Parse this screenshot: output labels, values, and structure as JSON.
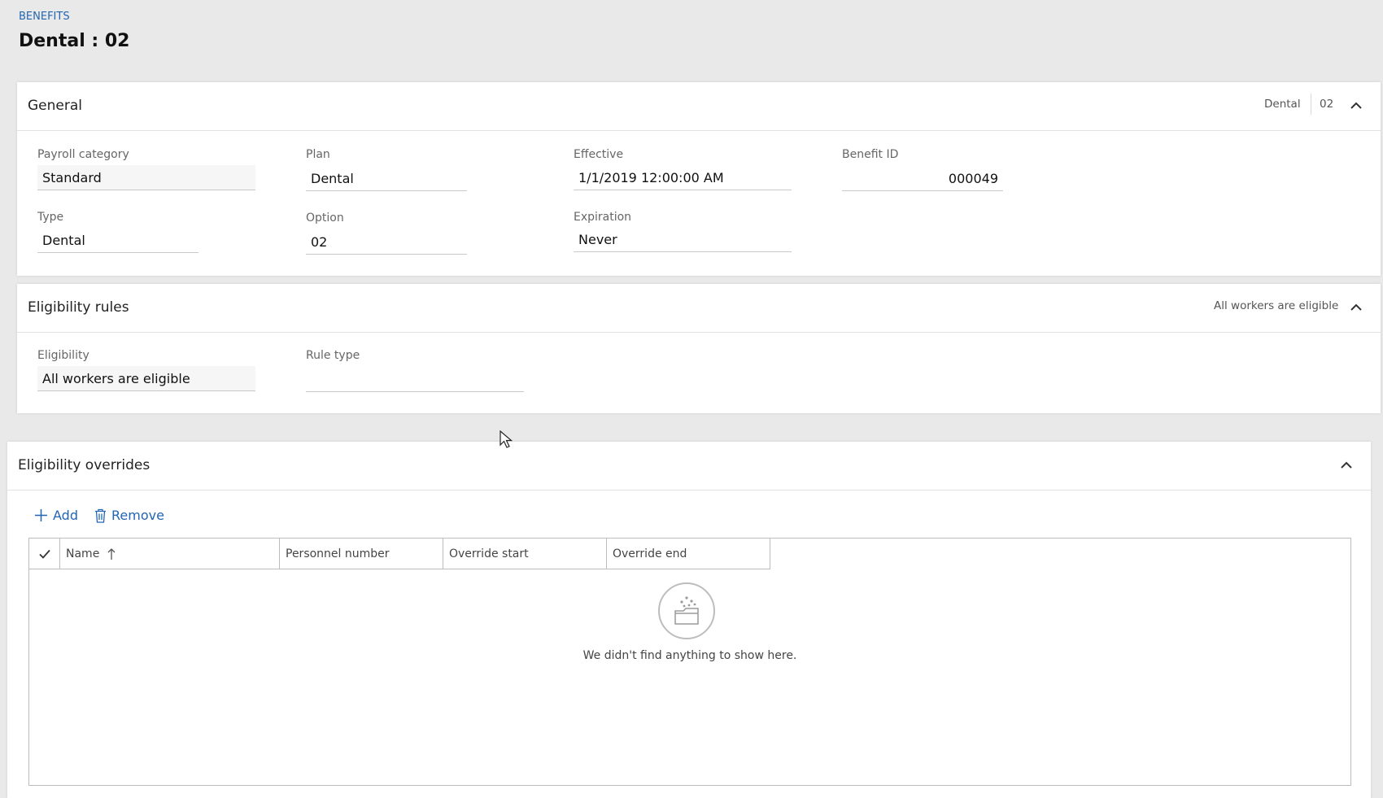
{
  "breadcrumb": "BENEFITS",
  "page_title": "Dental : 02",
  "general": {
    "title": "General",
    "summary": [
      "Dental",
      "02"
    ],
    "fields": {
      "payroll_category": {
        "label": "Payroll category",
        "value": "Standard"
      },
      "plan": {
        "label": "Plan",
        "value": "Dental"
      },
      "effective": {
        "label": "Effective",
        "value": "1/1/2019 12:00:00 AM"
      },
      "benefit_id": {
        "label": "Benefit ID",
        "value": "000049"
      },
      "type": {
        "label": "Type",
        "value": "Dental"
      },
      "option": {
        "label": "Option",
        "value": "02"
      },
      "expiration": {
        "label": "Expiration",
        "value": "Never"
      }
    }
  },
  "eligibility_rules": {
    "title": "Eligibility rules",
    "summary": "All workers are eligible",
    "fields": {
      "eligibility": {
        "label": "Eligibility",
        "value": "All workers are eligible"
      },
      "rule_type": {
        "label": "Rule type",
        "value": ""
      }
    }
  },
  "eligibility_overrides": {
    "title": "Eligibility overrides",
    "toolbar": {
      "add": "Add",
      "remove": "Remove"
    },
    "columns": [
      "Name",
      "Personnel number",
      "Override start",
      "Override end"
    ],
    "empty_message": "We didn't find anything to show here."
  },
  "icons": {
    "collapse": "chevron-up-icon",
    "add": "plus-icon",
    "remove": "trash-icon",
    "select_all": "checkmark-icon",
    "sort": "sort-ascending-icon",
    "empty": "empty-folder-icon"
  },
  "colors": {
    "accent": "#2266b3",
    "page_bg": "#e9e9e9"
  }
}
